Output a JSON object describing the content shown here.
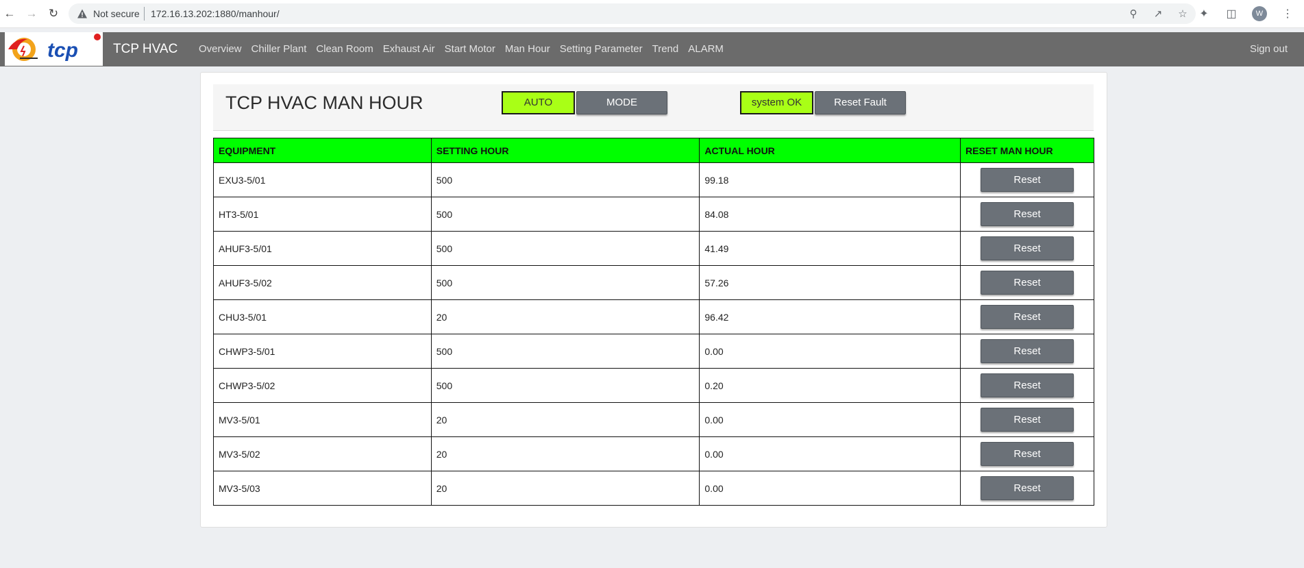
{
  "browser": {
    "security_label": "Not secure",
    "url": "172.16.13.202:1880/manhour/",
    "profile_initial": "W"
  },
  "navbar": {
    "brand": "TCP HVAC",
    "items": [
      "Overview",
      "Chiller Plant",
      "Clean Room",
      "Exhaust Air",
      "Start Motor",
      "Man Hour",
      "Setting Parameter",
      "Trend",
      "ALARM"
    ],
    "sign_out": "Sign out"
  },
  "header": {
    "title": "TCP HVAC MAN HOUR",
    "auto_label": "AUTO",
    "mode_label": "MODE",
    "status_label": "system OK",
    "reset_fault_label": "Reset Fault"
  },
  "table": {
    "columns": [
      "EQUIPMENT",
      "SETTING HOUR",
      "ACTUAL HOUR",
      "RESET MAN HOUR"
    ],
    "reset_label": "Reset",
    "rows": [
      {
        "equipment": "EXU3-5/01",
        "setting": "500",
        "actual": "99.18"
      },
      {
        "equipment": "HT3-5/01",
        "setting": "500",
        "actual": "84.08"
      },
      {
        "equipment": "AHUF3-5/01",
        "setting": "500",
        "actual": "41.49"
      },
      {
        "equipment": "AHUF3-5/02",
        "setting": "500",
        "actual": "57.26"
      },
      {
        "equipment": "CHU3-5/01",
        "setting": "20",
        "actual": "96.42"
      },
      {
        "equipment": "CHWP3-5/01",
        "setting": "500",
        "actual": "0.00"
      },
      {
        "equipment": "CHWP3-5/02",
        "setting": "500",
        "actual": "0.20"
      },
      {
        "equipment": "MV3-5/01",
        "setting": "20",
        "actual": "0.00"
      },
      {
        "equipment": "MV3-5/02",
        "setting": "20",
        "actual": "0.00"
      },
      {
        "equipment": "MV3-5/03",
        "setting": "20",
        "actual": "0.00"
      }
    ]
  },
  "colors": {
    "header_green": "#00ff00",
    "indicator_green": "#a9ff16",
    "button_gray": "#6b7178",
    "navbar_gray": "#6b6b6b"
  }
}
